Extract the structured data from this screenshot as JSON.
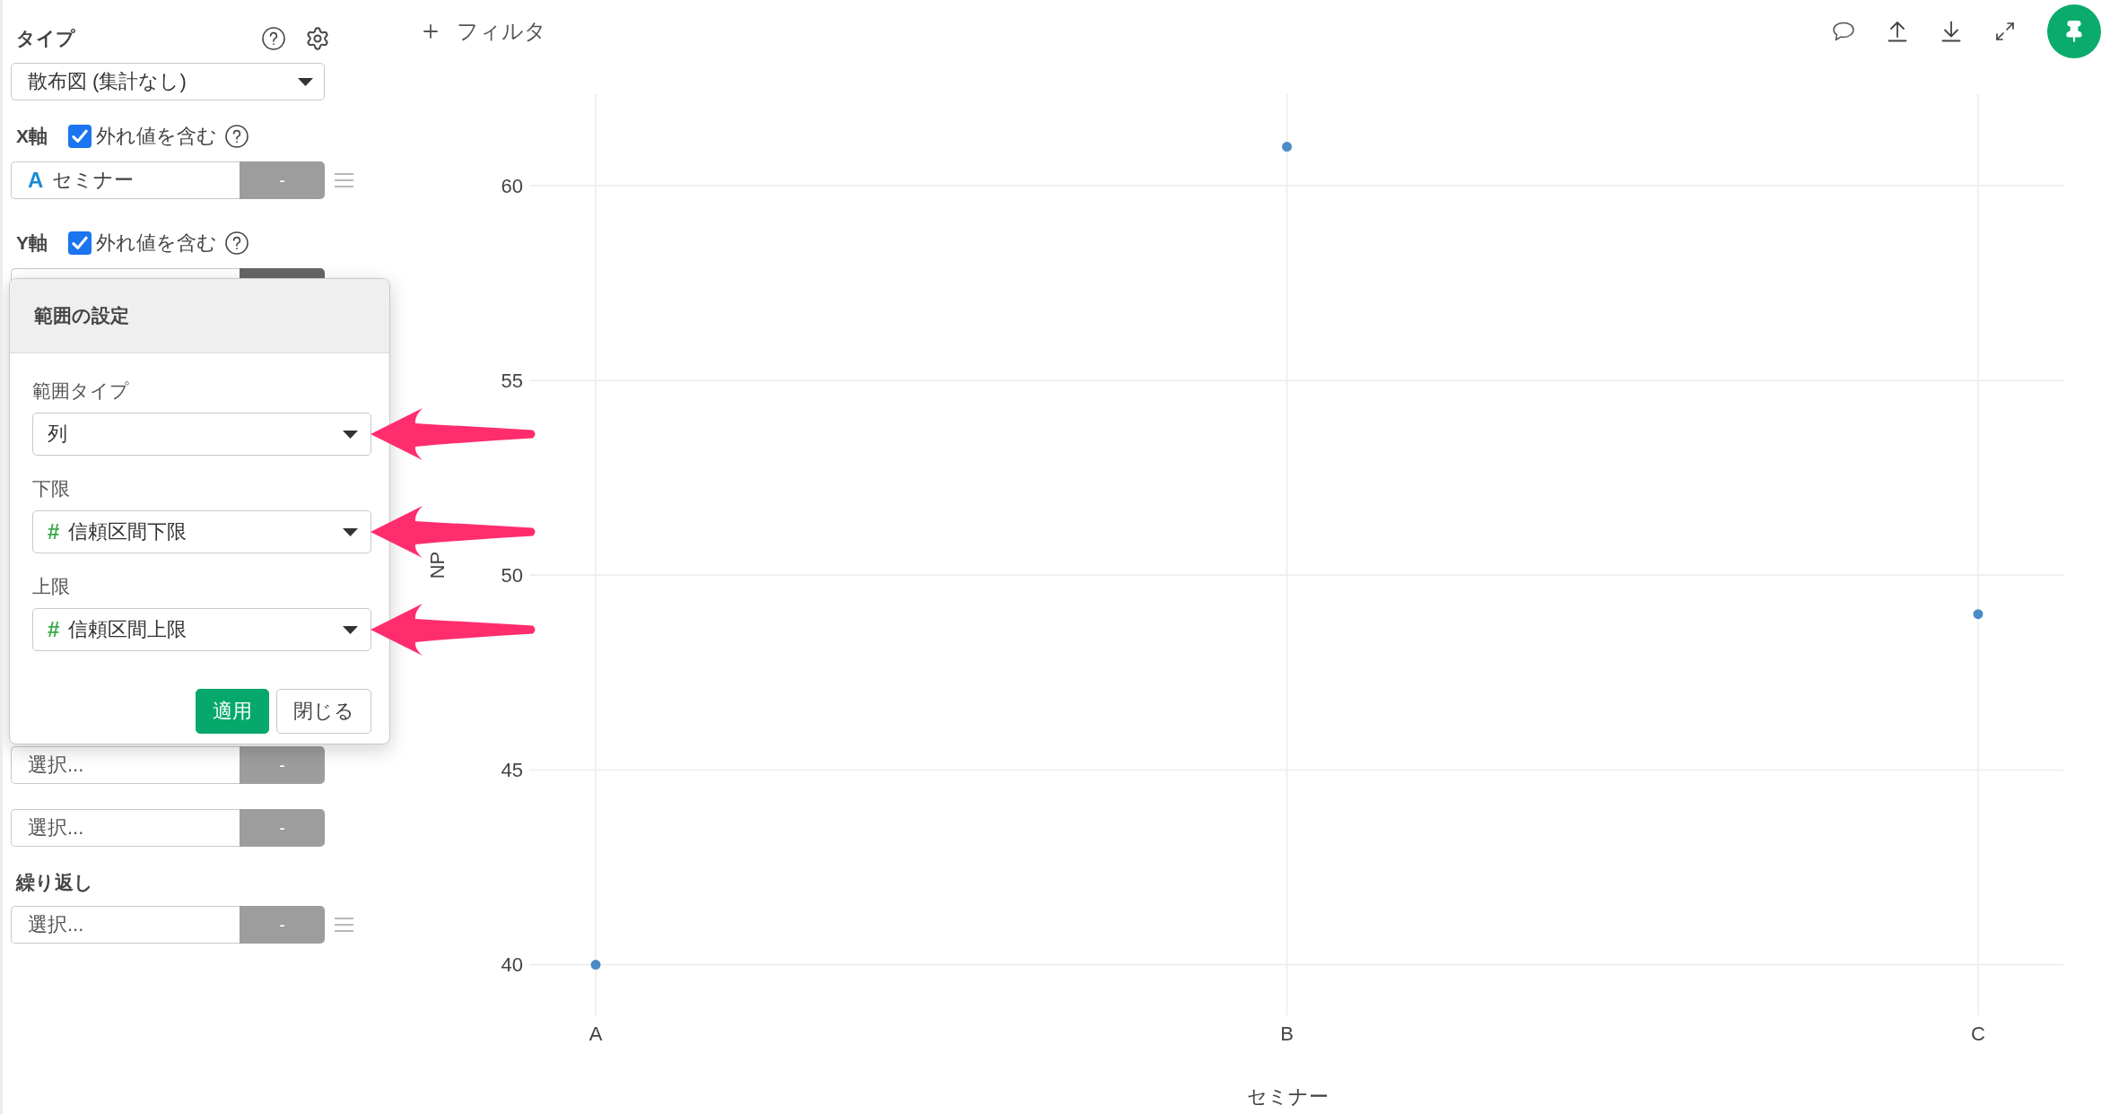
{
  "sidebar": {
    "chart_type": {
      "label": "タイプ",
      "value": "散布図 (集計なし)"
    },
    "axes": [
      {
        "label": "X軸",
        "outliers": {
          "label": "外れ値を含む",
          "checked": true
        },
        "column": {
          "type_mark": "A",
          "kind": "text",
          "value": "セミナー",
          "button": "-",
          "active": false,
          "menu": true
        }
      },
      {
        "label": "Y軸",
        "outliers": {
          "label": "外れ値を含む",
          "checked": true
        },
        "column": {
          "active": true
        }
      }
    ],
    "fields": [
      {
        "placeholder": "選択...",
        "button": "-",
        "active": false
      },
      {
        "placeholder": "選択...",
        "button": "-",
        "active": false
      }
    ],
    "repeat": {
      "label": "繰り返し",
      "field": {
        "placeholder": "選択...",
        "button": "-",
        "active": false,
        "menu": true
      }
    }
  },
  "range_popover": {
    "title": "範囲の設定",
    "fields": [
      {
        "label": "範囲タイプ",
        "value": "列",
        "pointed_out": true
      },
      {
        "label": "下限",
        "type_mark": "#",
        "kind": "number",
        "value": "信頼区間下限",
        "pointed_out": true
      },
      {
        "label": "上限",
        "type_mark": "#",
        "kind": "number",
        "value": "信頼区間上限",
        "pointed_out": true
      }
    ],
    "buttons": [
      {
        "label": "適用",
        "kind": "primary"
      },
      {
        "label": "閉じる",
        "kind": "secondary"
      }
    ]
  },
  "toolbar": {
    "filter": "フィルタ"
  },
  "chart": {
    "chart_data": {
      "type": "scatter",
      "xlabel": "セミナー",
      "ylabel": "NP",
      "categories": [
        "A",
        "B",
        "C"
      ],
      "series": [
        {
          "color": "#4a8bc6",
          "values": [
            40,
            61,
            49
          ]
        }
      ],
      "ylim": [
        38.7,
        62.35
      ],
      "yticks": [
        40,
        45,
        50,
        55,
        60
      ],
      "grid": true
    }
  }
}
